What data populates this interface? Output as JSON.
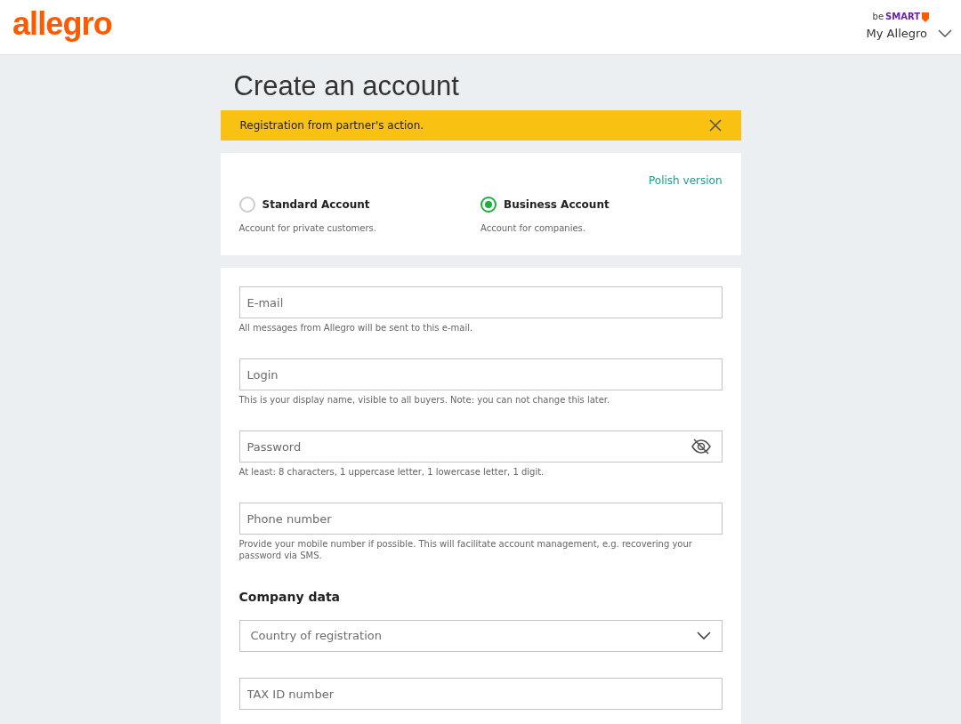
{
  "header": {
    "logo": "allegro",
    "promo_prefix": "be",
    "promo": "SMART",
    "menu": "My Allegro"
  },
  "title": "Create an account",
  "banner": {
    "text": "Registration from partner's action."
  },
  "account_types": {
    "language_link": "Polish version",
    "options": [
      {
        "label": "Standard Account",
        "description": "Account for private customers.",
        "selected": false
      },
      {
        "label": "Business Account",
        "description": "Account for companies.",
        "selected": true
      }
    ]
  },
  "form": {
    "fields": [
      {
        "kind": "text",
        "placeholder": "E-mail",
        "help": "All messages from Allegro will be sent to this e-mail."
      },
      {
        "kind": "text",
        "placeholder": "Login",
        "help": "This is your display name, visible to all buyers. Note: you can not change this later."
      },
      {
        "kind": "password",
        "placeholder": "Password",
        "help": "At least: 8 characters, 1 uppercase letter, 1 lowercase letter, 1 digit."
      },
      {
        "kind": "text",
        "placeholder": "Phone number",
        "help": "Provide your mobile number if possible. This will facilitate account management, e.g. recovering your password via SMS."
      }
    ],
    "section": "Company data",
    "company_fields": [
      {
        "kind": "select",
        "placeholder": "Country of registration"
      },
      {
        "kind": "text",
        "placeholder": "TAX ID number"
      }
    ]
  }
}
